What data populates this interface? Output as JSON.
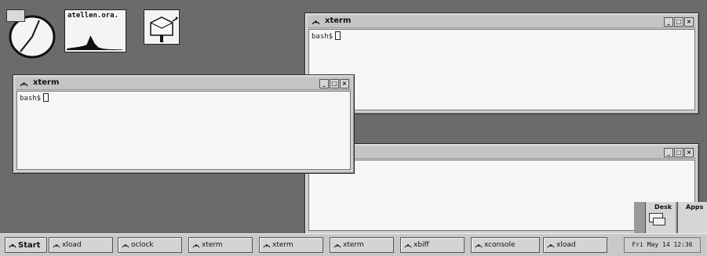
{
  "desktop": {
    "xload_host": "atellen.ora.",
    "xload_samples": [
      0.05,
      0.08,
      0.1,
      0.12,
      0.15,
      0.2,
      0.55,
      0.25,
      0.1,
      0.06,
      0.04,
      0.03,
      0.03,
      0.02,
      0.02
    ]
  },
  "windows": [
    {
      "title": "xterm",
      "prompt": "bash$"
    },
    {
      "title": "xterm",
      "prompt": "bash$"
    },
    {
      "title": "",
      "prompt": ""
    }
  ],
  "window_controls": {
    "minimize": "_",
    "maximize": "□",
    "close": "×"
  },
  "pager": {
    "desks": [
      "Desk",
      "Apps"
    ]
  },
  "taskbar": {
    "start_label": "Start",
    "tasks": [
      "xload",
      "oclock",
      "xterm",
      "xterm",
      "xterm",
      "xbiff",
      "xconsole",
      "xload"
    ],
    "clock": "Fri May 14 12:36"
  },
  "icons": {
    "window": "xterm-icon",
    "start": "start-icon",
    "mail": "mailbox-icon"
  }
}
